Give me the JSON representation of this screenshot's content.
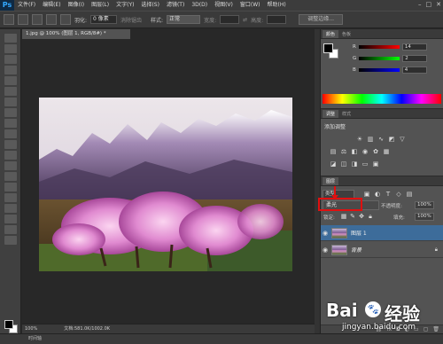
{
  "app": {
    "logo": "Ps"
  },
  "menu": [
    "文件(F)",
    "编辑(E)",
    "图像(I)",
    "图层(L)",
    "文字(Y)",
    "选择(S)",
    "滤镜(T)",
    "3D(D)",
    "视图(V)",
    "窗口(W)",
    "帮助(H)"
  ],
  "options": {
    "feather_label": "羽化:",
    "feather_value": "0 像素",
    "antialias_label": "消除锯齿",
    "style_label": "样式:",
    "style_value": "正常",
    "width_label": "宽度:",
    "height_label": "高度:",
    "refine_edge": "调整边缘..."
  },
  "document": {
    "tab_title": "1.jpg @ 100% (图层 1, RGB/8#) *",
    "zoom": "100%",
    "doc_info": "文档:581.0K/1002.0K"
  },
  "timeline_label": "时间轴",
  "color_panel": {
    "tabs": [
      "颜色",
      "色板"
    ],
    "r_label": "R",
    "r_value": "14",
    "g_label": "G",
    "g_value": "2",
    "b_label": "B",
    "b_value": "4"
  },
  "adjust_panel": {
    "tabs": [
      "调整",
      "样式"
    ],
    "title": "添加调整"
  },
  "layers_panel": {
    "tabs": [
      "图层"
    ],
    "kind_label": "类型",
    "blend_mode": "柔光",
    "opacity_label": "不透明度:",
    "opacity_value": "100%",
    "lock_label": "锁定:",
    "fill_label": "填充:",
    "fill_value": "100%",
    "layers": [
      {
        "name": "图层 1",
        "selected": true
      },
      {
        "name": "背景",
        "selected": false
      }
    ]
  },
  "watermark": {
    "brand": "Bai",
    "brand2": "经验",
    "url": "jingyan.baidu.com"
  }
}
